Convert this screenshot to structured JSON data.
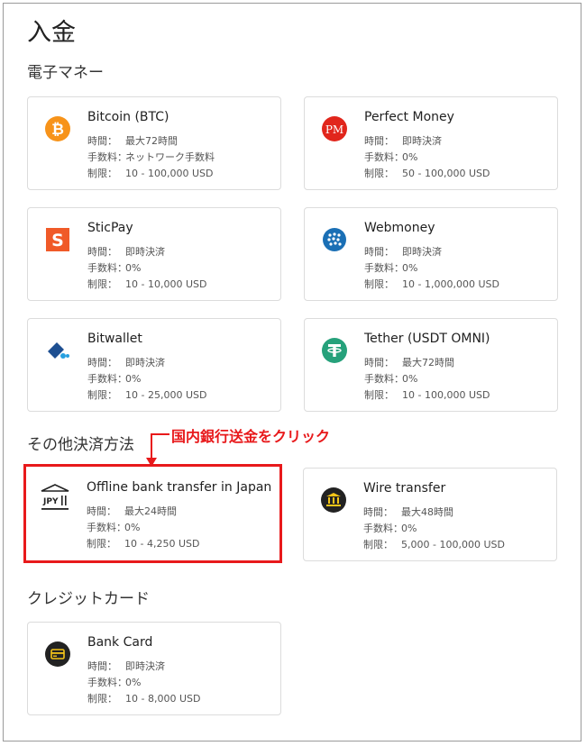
{
  "page": {
    "title": "入金"
  },
  "sections": {
    "e_money": "電子マネー",
    "other": "その他決済方法",
    "credit": "クレジットカード"
  },
  "labels": {
    "time": "時間：",
    "fee": "手数料：",
    "limit": "制限："
  },
  "methods": {
    "bitcoin": {
      "name": "Bitcoin (BTC)",
      "time": "最大72時間",
      "fee": "ネットワーク手数料",
      "limit": "10 - 100,000 USD",
      "icon": "bitcoin-icon"
    },
    "perfect": {
      "name": "Perfect Money",
      "time": "即時決済",
      "fee": "0%",
      "limit": "50 - 100,000 USD",
      "icon": "perfect-money-icon"
    },
    "sticpay": {
      "name": "SticPay",
      "time": "即時決済",
      "fee": "0%",
      "limit": "10 - 10,000 USD",
      "icon": "sticpay-icon"
    },
    "webmoney": {
      "name": "Webmoney",
      "time": "即時決済",
      "fee": "0%",
      "limit": "10 - 1,000,000 USD",
      "icon": "webmoney-icon"
    },
    "bitwallet": {
      "name": "Bitwallet",
      "time": "即時決済",
      "fee": "0%",
      "limit": "10 - 25,000 USD",
      "icon": "bitwallet-icon"
    },
    "tether": {
      "name": "Tether (USDT OMNI)",
      "time": "最大72時間",
      "fee": "0%",
      "limit": "10 - 100,000 USD",
      "icon": "tether-icon"
    },
    "offline": {
      "name": "Offline bank transfer in Japan",
      "time": "最大24時間",
      "fee": "0%",
      "limit": "10 - 4,250 USD",
      "icon": "jpy-bank-icon",
      "icon_text": "JPY"
    },
    "wire": {
      "name": "Wire transfer",
      "time": "最大48時間",
      "fee": "0%",
      "limit": "5,000 - 100,000 USD",
      "icon": "bank-icon"
    },
    "card": {
      "name": "Bank Card",
      "time": "即時決済",
      "fee": "0%",
      "limit": "10 - 8,000 USD",
      "icon": "credit-card-icon"
    }
  },
  "annotation": {
    "text": "国内銀行送金をクリック",
    "color": "#e8191b"
  },
  "colors": {
    "bitcoin": "#f7931a",
    "perfect": "#e1261c",
    "sticpay": "#f05a28",
    "webmoney": "#1a6fb5",
    "bitwallet": "#1d4f91",
    "tether": "#26a17b",
    "dark": "#222222"
  }
}
